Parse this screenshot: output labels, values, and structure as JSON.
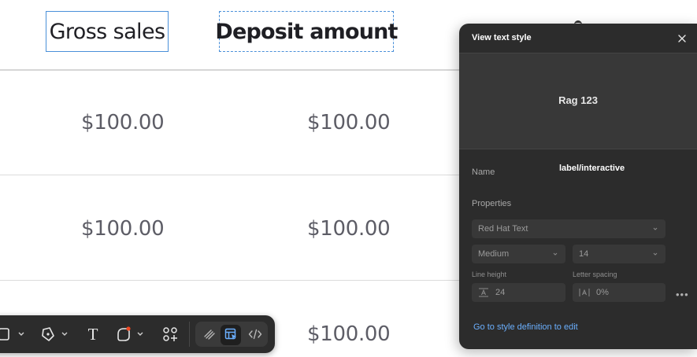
{
  "table": {
    "headers": {
      "gross_sales": "Gross sales",
      "deposit_amount": "Deposit amount"
    },
    "rows": [
      {
        "gross": "$100.00",
        "deposit": "$100.00"
      },
      {
        "gross": "$100.00",
        "deposit": "$100.00"
      },
      {
        "gross": "",
        "deposit": "$100.00"
      }
    ]
  },
  "toolbar": {
    "tools": [
      {
        "name": "frame-tool",
        "icon": "frame-icon"
      },
      {
        "name": "pen-tool",
        "icon": "pen-icon"
      },
      {
        "name": "text-tool",
        "icon": "text-icon"
      },
      {
        "name": "shape-tool",
        "icon": "shape-icon"
      },
      {
        "name": "components-tool",
        "icon": "components-icon"
      },
      {
        "name": "draw-mode",
        "icon": "draw-icon"
      },
      {
        "name": "design-mode",
        "icon": "design-icon"
      },
      {
        "name": "dev-mode",
        "icon": "code-icon"
      }
    ],
    "text_glyph": "T",
    "active_mode": "design-mode",
    "accent_dot_color": "#f24822"
  },
  "panel": {
    "title": "View text style",
    "preview_sample": "Rag 123",
    "name_label": "Name",
    "name_value": "label/interactive",
    "properties_label": "Properties",
    "font_family": "Red Hat Text",
    "font_weight": "Medium",
    "font_size": "14",
    "line_height_label": "Line height",
    "line_height_value": "24",
    "letter_spacing_label": "Letter spacing",
    "letter_spacing_value": "0%",
    "more_glyph": "•••",
    "link_text": "Go to style definition to edit"
  },
  "colors": {
    "selection_border": "#4a90d9",
    "panel_bg": "#2c2c2c",
    "link": "#6aaefc"
  }
}
